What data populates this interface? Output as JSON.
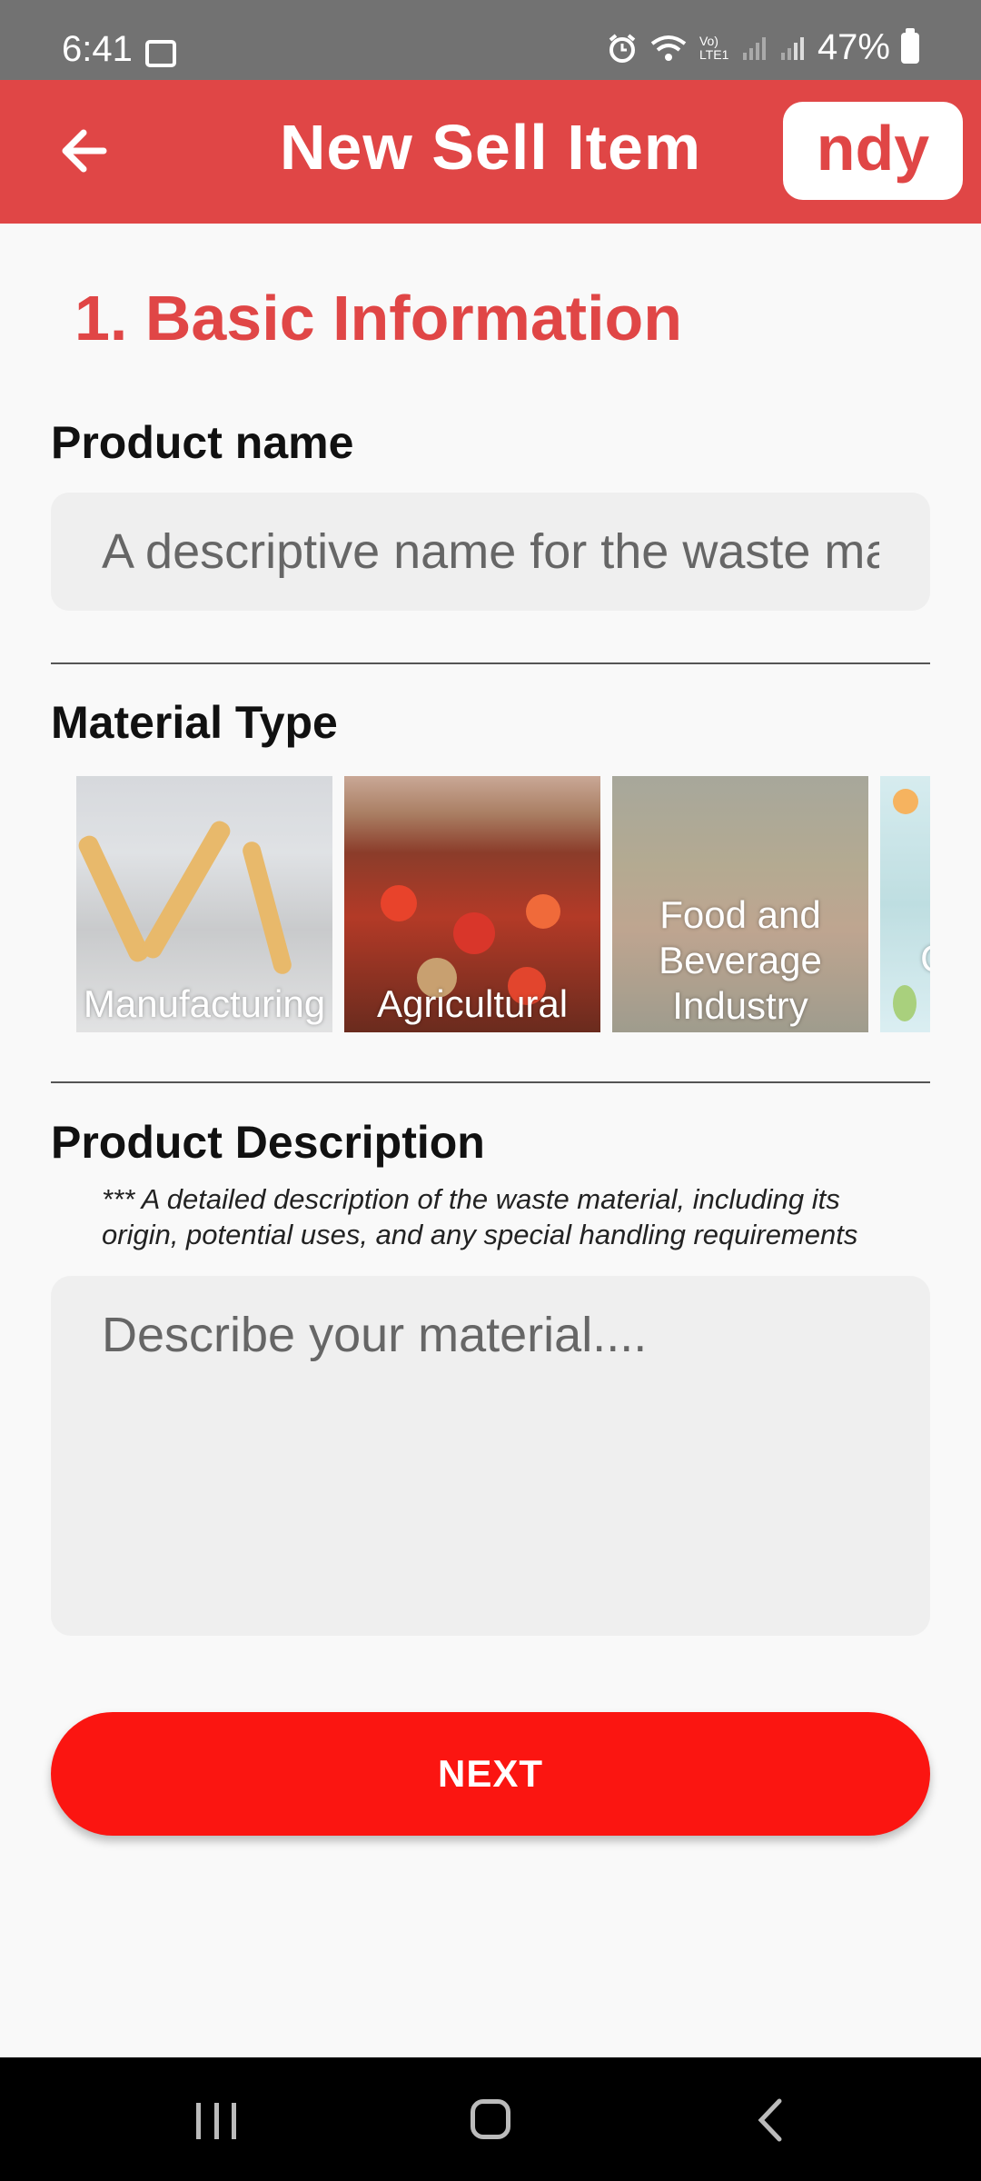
{
  "status_bar": {
    "time": "6:41",
    "battery": "47%",
    "carrier_badge": "Vo) LTE1"
  },
  "app_bar": {
    "title": "New Sell Item",
    "logo_text": "ndy",
    "color": "#e04646"
  },
  "section": {
    "title": "1. Basic Information"
  },
  "product_name": {
    "label": "Product name",
    "placeholder": "A descriptive name for the waste material"
  },
  "material_type": {
    "label": "Material Type",
    "options": [
      {
        "label": "Manufacturing"
      },
      {
        "label": "Agricultural"
      },
      {
        "label": "Food and Beverage Industry"
      },
      {
        "label": "Consumer Goods"
      }
    ]
  },
  "product_description": {
    "label": "Product Description",
    "hint_line1": "*** A detailed description of the waste material, including its",
    "hint_line2": "origin, potential uses, and any special handling requirements",
    "placeholder": "Describe your material...."
  },
  "actions": {
    "next_label": "NEXT",
    "accent": "#fb1511"
  }
}
